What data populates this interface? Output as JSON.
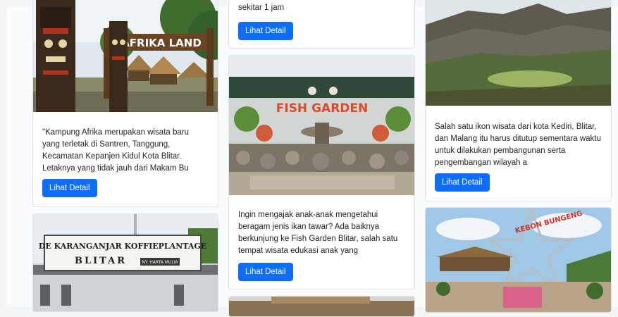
{
  "cards": [
    {
      "id": "kampung-afrika",
      "image_sign": "AFRIKA LAND",
      "description": "\"Kampung Afrika merupakan wisata baru yang terletak di Santren, Tanggung, Kecamatan Kepanjen Kidul Kota Blitar. Letaknya yang tidak jauh dari Makam Bu",
      "button": "Lihat Detail"
    },
    {
      "id": "cut-top",
      "description": "sekitar 1 jam",
      "button": "Lihat Detail"
    },
    {
      "id": "fish-garden",
      "image_sign": "FISH GARDEN",
      "description": "Ingin mengajak anak-anak mengetahui beragam jenis ikan tawar? Ada baiknya berkunjung ke Fish Garden Blitar, salah satu tempat wisata edukasi anak yang",
      "button": "Lihat Detail"
    },
    {
      "id": "kelud",
      "description": "Salah satu ikon wisata dari kota Kediri, Blitar, dan Malang itu harus ditutup sementara waktu untuk dilakukan pembangunan serta pengembangan wilayah a",
      "button": "Lihat Detail"
    },
    {
      "id": "karanganjar",
      "image_sign_line1": "DE KARANGANJAR KOFFIEPLANTAGE",
      "image_sign_line2": "BLITAR",
      "image_sign_small": "NY. HARTA MULIA"
    },
    {
      "id": "kebon-bunga",
      "image_sign": "KEBON BUNGENG"
    }
  ]
}
